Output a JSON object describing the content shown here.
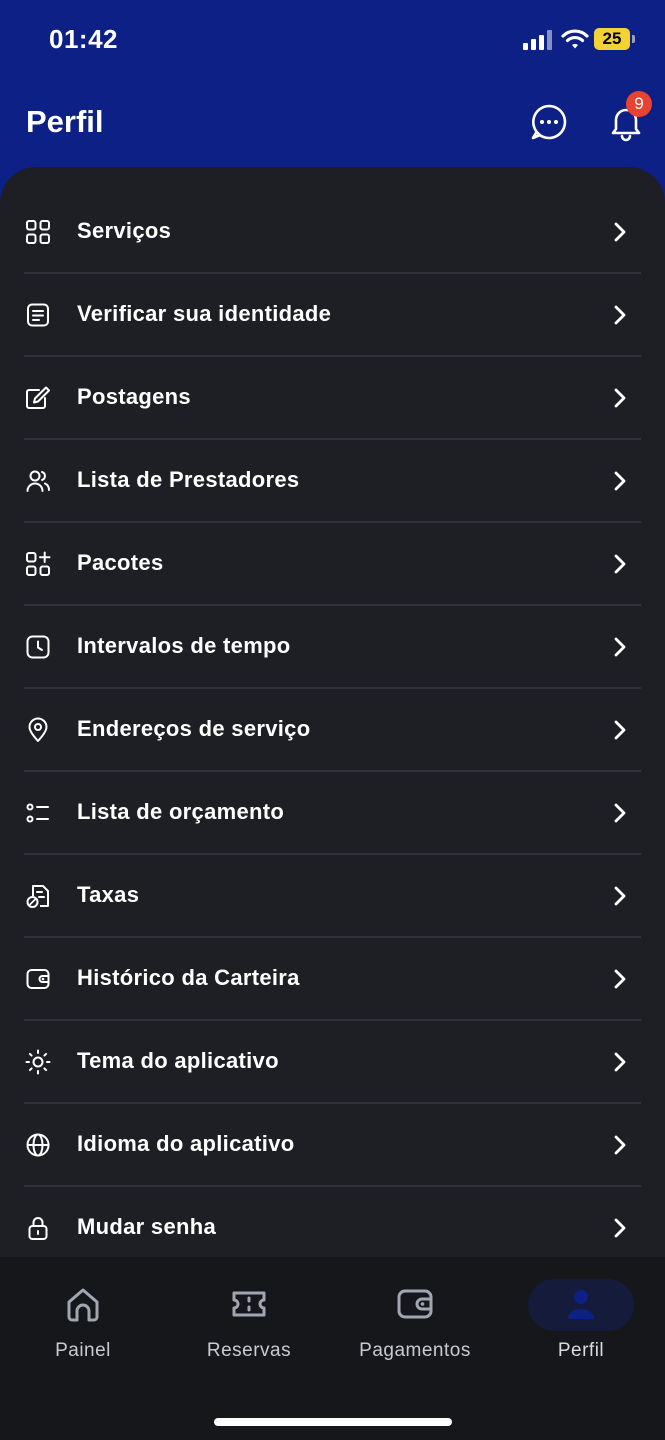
{
  "status_bar": {
    "time": "01:42",
    "battery": "25"
  },
  "header": {
    "title": "Perfil",
    "notification_count": "9"
  },
  "menu": [
    {
      "id": "servicos",
      "label": "Serviços",
      "icon": "grid-icon"
    },
    {
      "id": "verificar-identidade",
      "label": "Verificar sua identidade",
      "icon": "id-document-icon"
    },
    {
      "id": "postagens",
      "label": "Postagens",
      "icon": "edit-post-icon"
    },
    {
      "id": "lista-prestadores",
      "label": "Lista de Prestadores",
      "icon": "users-icon"
    },
    {
      "id": "pacotes",
      "label": "Pacotes",
      "icon": "grid-plus-icon"
    },
    {
      "id": "intervalos-tempo",
      "label": "Intervalos de tempo",
      "icon": "clock-icon"
    },
    {
      "id": "enderecos-servico",
      "label": "Endereços de serviço",
      "icon": "location-pin-icon"
    },
    {
      "id": "lista-orcamento",
      "label": "Lista de orçamento",
      "icon": "checklist-icon"
    },
    {
      "id": "taxas",
      "label": "Taxas",
      "icon": "tax-document-icon"
    },
    {
      "id": "historico-carteira",
      "label": "Histórico da Carteira",
      "icon": "wallet-icon"
    },
    {
      "id": "tema-aplicativo",
      "label": "Tema do aplicativo",
      "icon": "sun-icon"
    },
    {
      "id": "idioma-aplicativo",
      "label": "Idioma do aplicativo",
      "icon": "globe-icon"
    },
    {
      "id": "mudar-senha",
      "label": "Mudar senha",
      "icon": "lock-icon"
    }
  ],
  "bottom_nav": [
    {
      "id": "painel",
      "label": "Painel",
      "icon": "home-icon",
      "active": false
    },
    {
      "id": "reservas",
      "label": "Reservas",
      "icon": "ticket-icon",
      "active": false
    },
    {
      "id": "pagamentos",
      "label": "Pagamentos",
      "icon": "wallet-icon",
      "active": false
    },
    {
      "id": "perfil",
      "label": "Perfil",
      "icon": "user-icon",
      "active": true
    }
  ],
  "colors": {
    "header_bg": "#0c2086",
    "content_bg": "#1e1f24",
    "nav_bg": "#16171b",
    "badge": "#e84233",
    "battery": "#f3d233",
    "active_nav": "#0c2086"
  }
}
